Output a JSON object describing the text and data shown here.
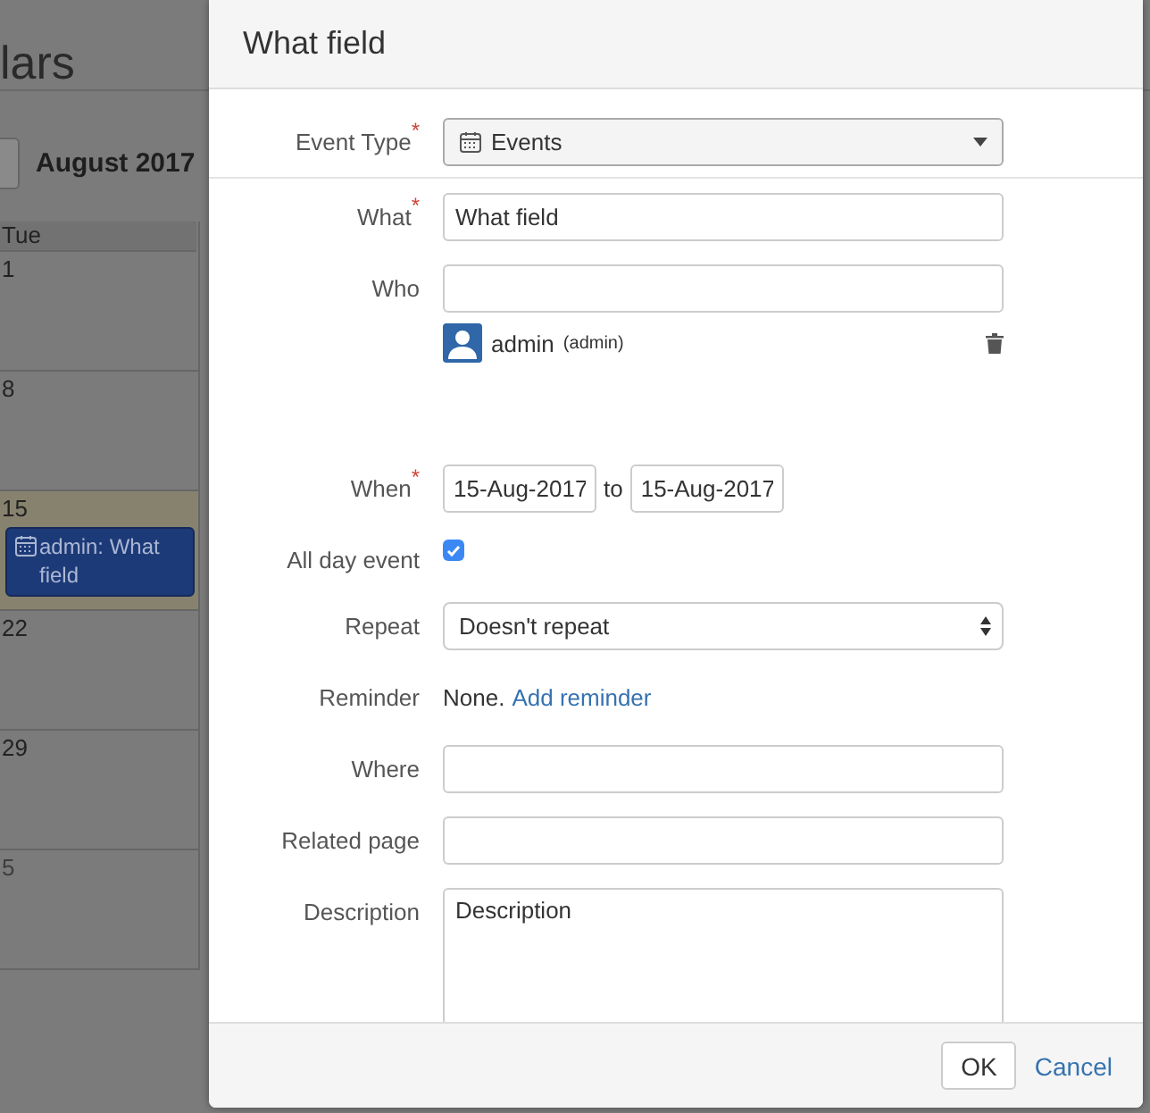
{
  "calendar": {
    "page_title": "lars",
    "month": "August 2017",
    "weekday": "Tue",
    "weeks": [
      {
        "day": "1",
        "other_month": false,
        "today": false
      },
      {
        "day": "8",
        "other_month": false,
        "today": false
      },
      {
        "day": "15",
        "other_month": false,
        "today": true,
        "event": "admin: What field"
      },
      {
        "day": "22",
        "other_month": false,
        "today": false
      },
      {
        "day": "29",
        "other_month": false,
        "today": false
      },
      {
        "day": "5",
        "other_month": true,
        "today": false
      }
    ]
  },
  "dialog": {
    "title": "What field",
    "fields": [
      {
        "kind": "select",
        "label": "Event Type",
        "required_mark": "*",
        "value": "Events"
      },
      {
        "kind": "text",
        "label": "What",
        "required_mark": "*",
        "value": "What field"
      },
      {
        "kind": "people",
        "label": "Who",
        "people": [
          {
            "name": "admin",
            "username": "(admin)"
          }
        ]
      },
      {
        "kind": "dates",
        "label": "When",
        "required_mark": "*",
        "from": "15-Aug-2017",
        "joiner": "to",
        "to": "15-Aug-2017"
      },
      {
        "kind": "checkbox",
        "label": "All day event",
        "checked": true
      },
      {
        "kind": "repeat",
        "label": "Repeat",
        "value": "Doesn't repeat"
      },
      {
        "kind": "reminder",
        "label": "Reminder",
        "value": "None.",
        "link": "Add reminder"
      },
      {
        "kind": "text",
        "label": "Where"
      },
      {
        "kind": "text",
        "label": "Related page"
      },
      {
        "kind": "textarea",
        "label": "Description",
        "value": "Description"
      }
    ],
    "buttons": {
      "ok": "OK",
      "cancel": "Cancel"
    }
  }
}
